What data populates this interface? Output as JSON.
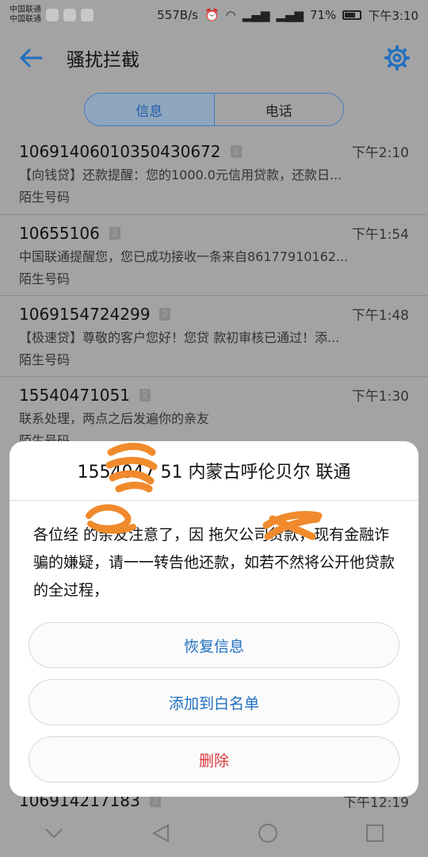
{
  "status": {
    "carrier1": "中国联通",
    "carrier2": "中国联通",
    "speed": "557B/s",
    "battery": "71%",
    "battery_level": 0.71,
    "time": "下午3:10"
  },
  "header": {
    "title": "骚扰拦截",
    "back_icon": "arrow-left-icon",
    "settings_icon": "gear-icon"
  },
  "tabs": [
    {
      "label": "信息"
    },
    {
      "label": "电话"
    }
  ],
  "messages": [
    {
      "sender": "10691406010350430672",
      "sim": "2",
      "time": "下午2:10",
      "preview": "【向钱贷】还款提醒：您的1000.0元信用贷款，还款日...",
      "tag": "陌生号码"
    },
    {
      "sender": "10655106",
      "sim": "2",
      "time": "下午1:54",
      "preview": "中国联通提醒您，您已成功接收一条来自86177910162...",
      "tag": "陌生号码"
    },
    {
      "sender": "1069154724299",
      "sim": "2",
      "time": "下午1:48",
      "preview": "【极速贷】尊敬的客户您好！您贷 款初审核已通过！添...",
      "tag": "陌生号码"
    },
    {
      "sender": "15540471051",
      "sim": "2",
      "time": "下午1:30",
      "preview": "联系处理，两点之后发遍你的亲友",
      "tag": "陌生号码"
    }
  ],
  "bottom_message": {
    "sender": "106914217183",
    "sim": "2",
    "time": "下午12:19"
  },
  "dialog": {
    "title": "1554047 51 内蒙古呼伦贝尔 联通",
    "body": "各位经    的亲友注意了，因        拖欠公司贷款，现有金融诈骗的嫌疑，请一一转告他还款，如若不然将公开他贷款的全过程，",
    "buttons": {
      "restore": "恢复信息",
      "whitelist": "添加到白名单",
      "delete": "删除"
    }
  },
  "colors": {
    "accent": "#1f6fbf",
    "danger": "#d9363a",
    "scribble": "#f08a2c"
  }
}
